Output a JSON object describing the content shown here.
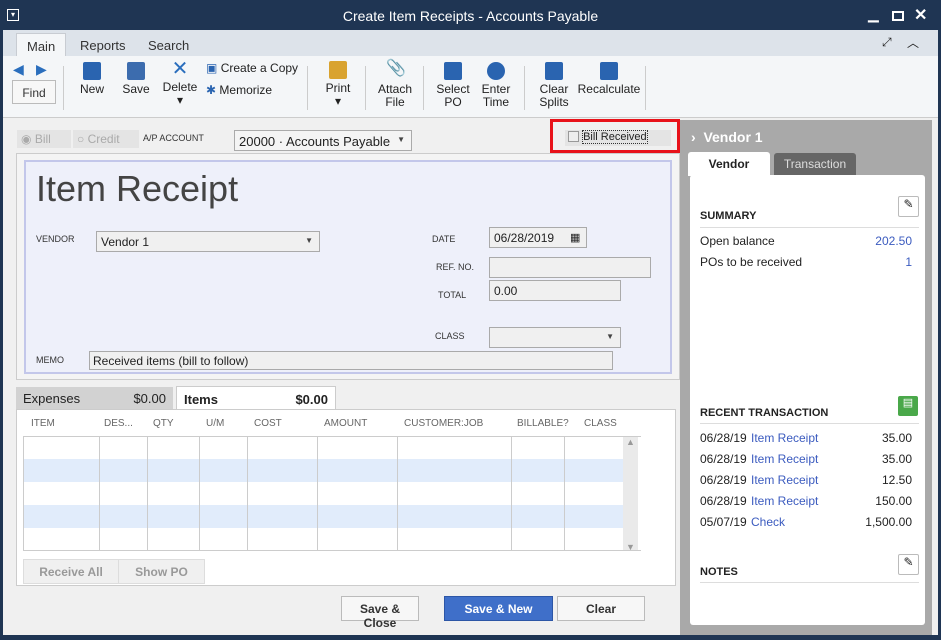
{
  "window": {
    "title": "Create Item Receipts - Accounts Payable"
  },
  "menu_tabs": [
    "Main",
    "Reports",
    "Search"
  ],
  "toolbar": {
    "find": "Find",
    "new": "New",
    "save": "Save",
    "delete": "Delete",
    "create_copy": "Create a Copy",
    "memorize": "Memorize",
    "print": "Print",
    "attach": "Attach File",
    "select_po": "Select PO",
    "enter_time": "Enter Time",
    "clear_splits": "Clear Splits",
    "recalculate": "Recalculate"
  },
  "form": {
    "bill": "Bill",
    "credit": "Credit",
    "ap_label": "A/P ACCOUNT",
    "ap_value": "20000 · Accounts Payable",
    "bill_received": "Bill Received",
    "bill_received_checked": false,
    "heading": "Item Receipt",
    "vendor_label": "VENDOR",
    "vendor": "Vendor 1",
    "date_label": "DATE",
    "date": "06/28/2019",
    "ref_label": "REF. NO.",
    "ref": "",
    "total_label": "TOTAL",
    "total": "0.00",
    "class_label": "CLASS",
    "class": "",
    "memo_label": "MEMO",
    "memo": "Received items (bill to follow)"
  },
  "detail_tabs": [
    {
      "label": "Expenses",
      "amount": "$0.00"
    },
    {
      "label": "Items",
      "amount": "$0.00"
    }
  ],
  "columns": [
    "ITEM",
    "DES...",
    "QTY",
    "U/M",
    "COST",
    "AMOUNT",
    "CUSTOMER:JOB",
    "BILLABLE?",
    "CLASS"
  ],
  "buttons": {
    "receive_all": "Receive All",
    "show_po": "Show PO",
    "save_close": "Save & Close",
    "save_new": "Save & New",
    "clear": "Clear"
  },
  "panel": {
    "title": "Vendor 1",
    "tabs": [
      "Vendor",
      "Transaction"
    ],
    "summary_title": "SUMMARY",
    "summary": [
      {
        "label": "Open balance",
        "value": "202.50"
      },
      {
        "label": "POs to be received",
        "value": "1"
      }
    ],
    "recent_title": "RECENT TRANSACTION",
    "recent": [
      {
        "date": "06/28/19",
        "type": "Item Receipt",
        "amount": "35.00"
      },
      {
        "date": "06/28/19",
        "type": "Item Receipt",
        "amount": "35.00"
      },
      {
        "date": "06/28/19",
        "type": "Item Receipt",
        "amount": "12.50"
      },
      {
        "date": "06/28/19",
        "type": "Item Receipt",
        "amount": "150.00"
      },
      {
        "date": "05/07/19",
        "type": "Check",
        "amount": "1,500.00"
      }
    ],
    "notes_title": "NOTES"
  },
  "colors": {
    "accent": "#3f6fc9",
    "highlight": "#e8121a",
    "titlebar": "#1f3553"
  }
}
